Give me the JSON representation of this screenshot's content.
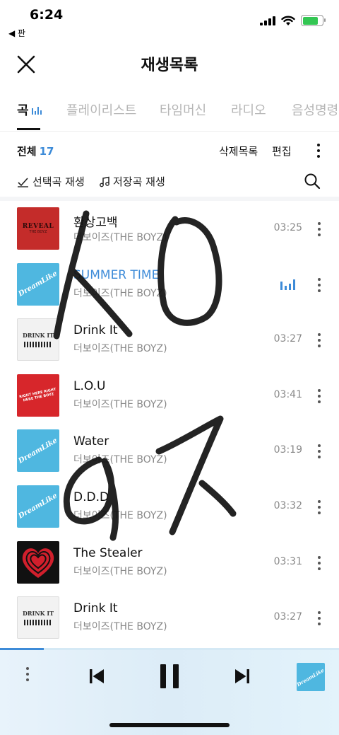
{
  "status_bar": {
    "time": "6:24",
    "back_label": "◀ 판"
  },
  "header": {
    "title": "재생목록"
  },
  "tabs": [
    {
      "label": "곡",
      "active": true
    },
    {
      "label": "플레이리스트"
    },
    {
      "label": "타임머신"
    },
    {
      "label": "라디오"
    },
    {
      "label": "음성명령"
    }
  ],
  "toolbar": {
    "total_label": "전체",
    "total_count": "17",
    "delete_label": "삭제목록",
    "edit_label": "편집"
  },
  "play_options": {
    "selected_play": "선택곡 재생",
    "saved_play": "저장곡 재생"
  },
  "songs": [
    {
      "title": "환상고백",
      "artist": "더보이즈(THE BOYZ)",
      "duration": "03:25",
      "cover": "REVEAL",
      "cover_sub": "THE BOYZ"
    },
    {
      "title": "SUMMER TIME",
      "artist": "더보이즈(THE BOYZ)",
      "duration": "",
      "cover": "DreamLike",
      "playing": true
    },
    {
      "title": "Drink It",
      "artist": "더보이즈(THE BOYZ)",
      "duration": "03:27",
      "cover": "DRINK IT"
    },
    {
      "title": "L.O.U",
      "artist": "더보이즈(THE BOYZ)",
      "duration": "03:41",
      "cover": "RIGHT HERE RIGHT HERE THE BOYZ"
    },
    {
      "title": "Water",
      "artist": "더보이즈(THE BOYZ)",
      "duration": "03:19",
      "cover": "DreamLike"
    },
    {
      "title": "D.D.D",
      "artist": "더보이즈(THE BOYZ)",
      "duration": "03:32",
      "cover": "DreamLike"
    },
    {
      "title": "The Stealer",
      "artist": "더보이즈(THE BOYZ)",
      "duration": "03:31",
      "cover": ""
    },
    {
      "title": "Drink It",
      "artist": "더보이즈(THE BOYZ)",
      "duration": "03:27",
      "cover": "DRINK IT"
    }
  ],
  "player": {
    "cover": "DreamLike",
    "progress": 0.13
  },
  "colors": {
    "accent": "#3d8bd8",
    "player_bg": "#e3f1fa"
  }
}
